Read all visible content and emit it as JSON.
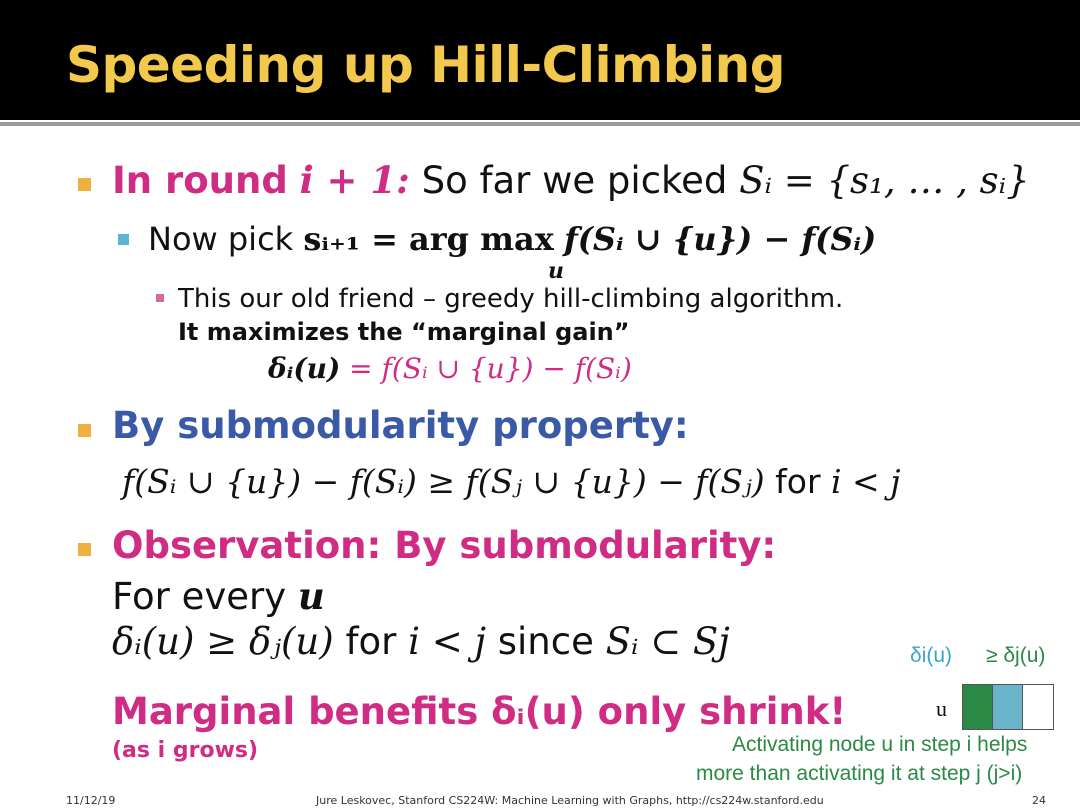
{
  "title": "Speeding up Hill-Climbing",
  "round": {
    "prefix": "In round",
    "i_plus_1": "i + 1:",
    "text": "So far we picked",
    "math": "Sᵢ = {s₁, … , sᵢ}"
  },
  "now_pick": {
    "label": "Now pick",
    "math_lhs": "sᵢ₊₁ = arg max",
    "math_under": "u",
    "math_rhs": "f(Sᵢ ∪ {u}) − f(Sᵢ)"
  },
  "old_friend": {
    "line1": "This our old friend – greedy hill-climbing algorithm.",
    "line2": "It maximizes the “marginal gain”",
    "delta_lhs": "δᵢ(u)",
    "delta_rhs": "= f(Sᵢ ∪ {u}) − f(Sᵢ)"
  },
  "submod": {
    "heading": "By submodularity property:",
    "formula": "f(Sᵢ ∪ {u}) − f(Sᵢ) ≥ f(Sⱼ ∪ {u}) − f(Sⱼ)",
    "for_word": "for",
    "condition": "i < j"
  },
  "observation": {
    "heading": "Observation: By submodularity:",
    "every_text": "For every",
    "every_var": "u",
    "ineq": "δᵢ(u) ≥ δⱼ(u)",
    "for_word": "for",
    "cond": "i <  j",
    "since_word": "since",
    "subset": "Sᵢ ⊂ Sj"
  },
  "marginal": {
    "text": "Marginal benefits δᵢ(u) only shrink!",
    "sub": "(as i grows)"
  },
  "diagram": {
    "delta_i": "δi(u)",
    "geq_delta_j": "≥ δj(u)",
    "node_label": "u",
    "caption_line1": "Activating node u in step i helps",
    "caption_line2": "more than activating it at step j (j>i)",
    "colors": [
      "#2a8a45",
      "#6ab4cc",
      "#ffffff"
    ]
  },
  "footer": {
    "date": "11/12/19",
    "center": "Jure Leskovec, Stanford CS224W: Machine Learning with Graphs, http://cs224w.stanford.edu",
    "page": "24"
  }
}
